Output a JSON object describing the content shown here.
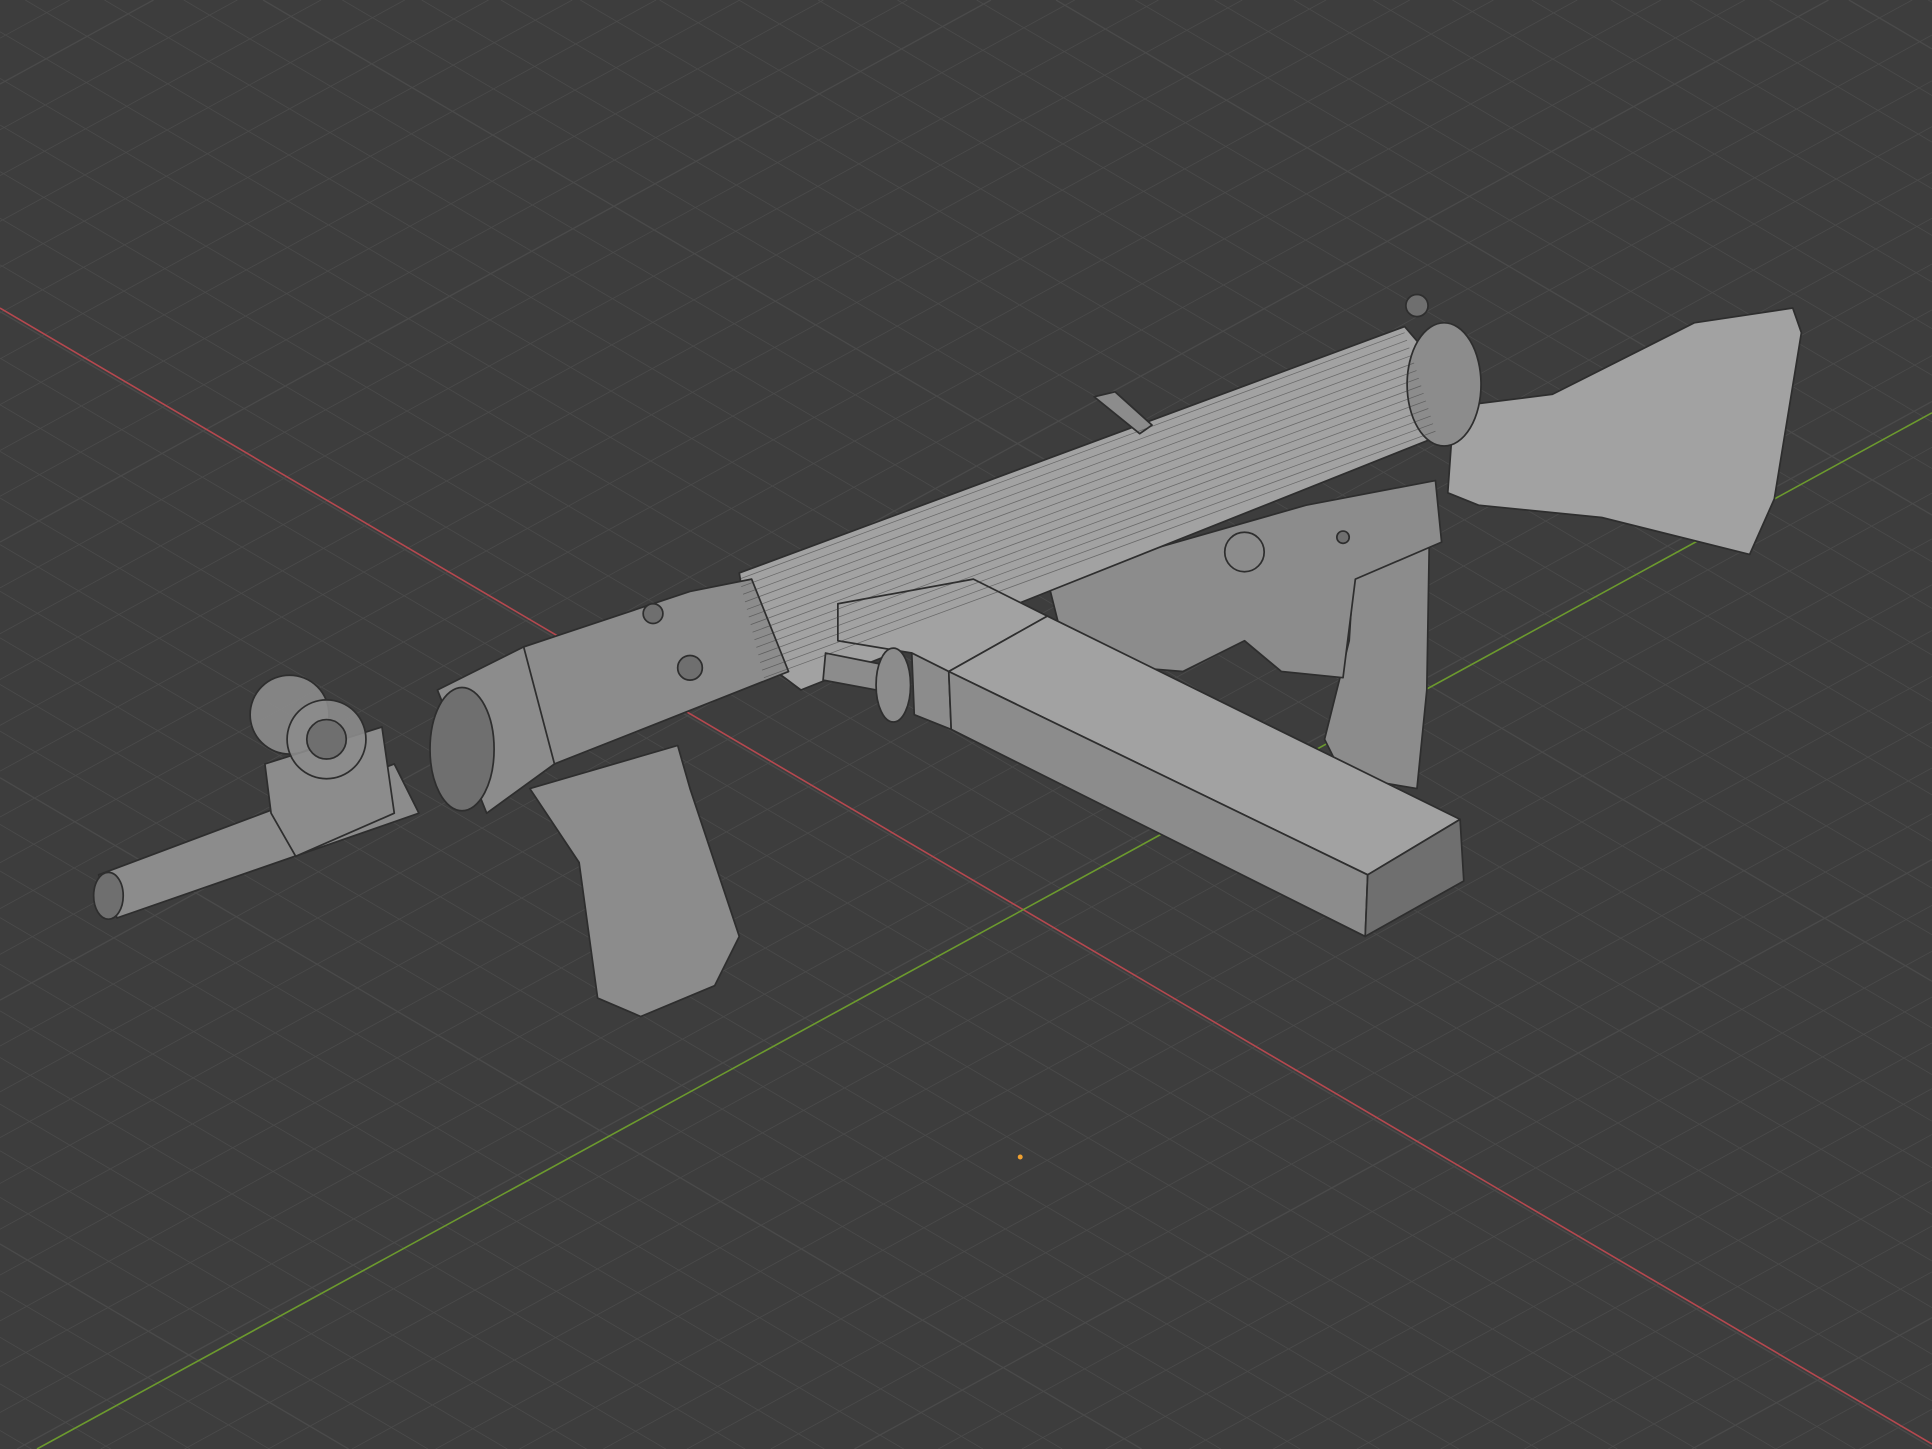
{
  "viewport": {
    "background": "#3d3d3d",
    "grid_color": "#4a4a4a",
    "x_axis_color": "#b5484f",
    "y_axis_color": "#6c9a2e",
    "origin_color": "#f0a030",
    "model_color": "#8c8c8c",
    "wire_color": "#2e2e2e"
  }
}
